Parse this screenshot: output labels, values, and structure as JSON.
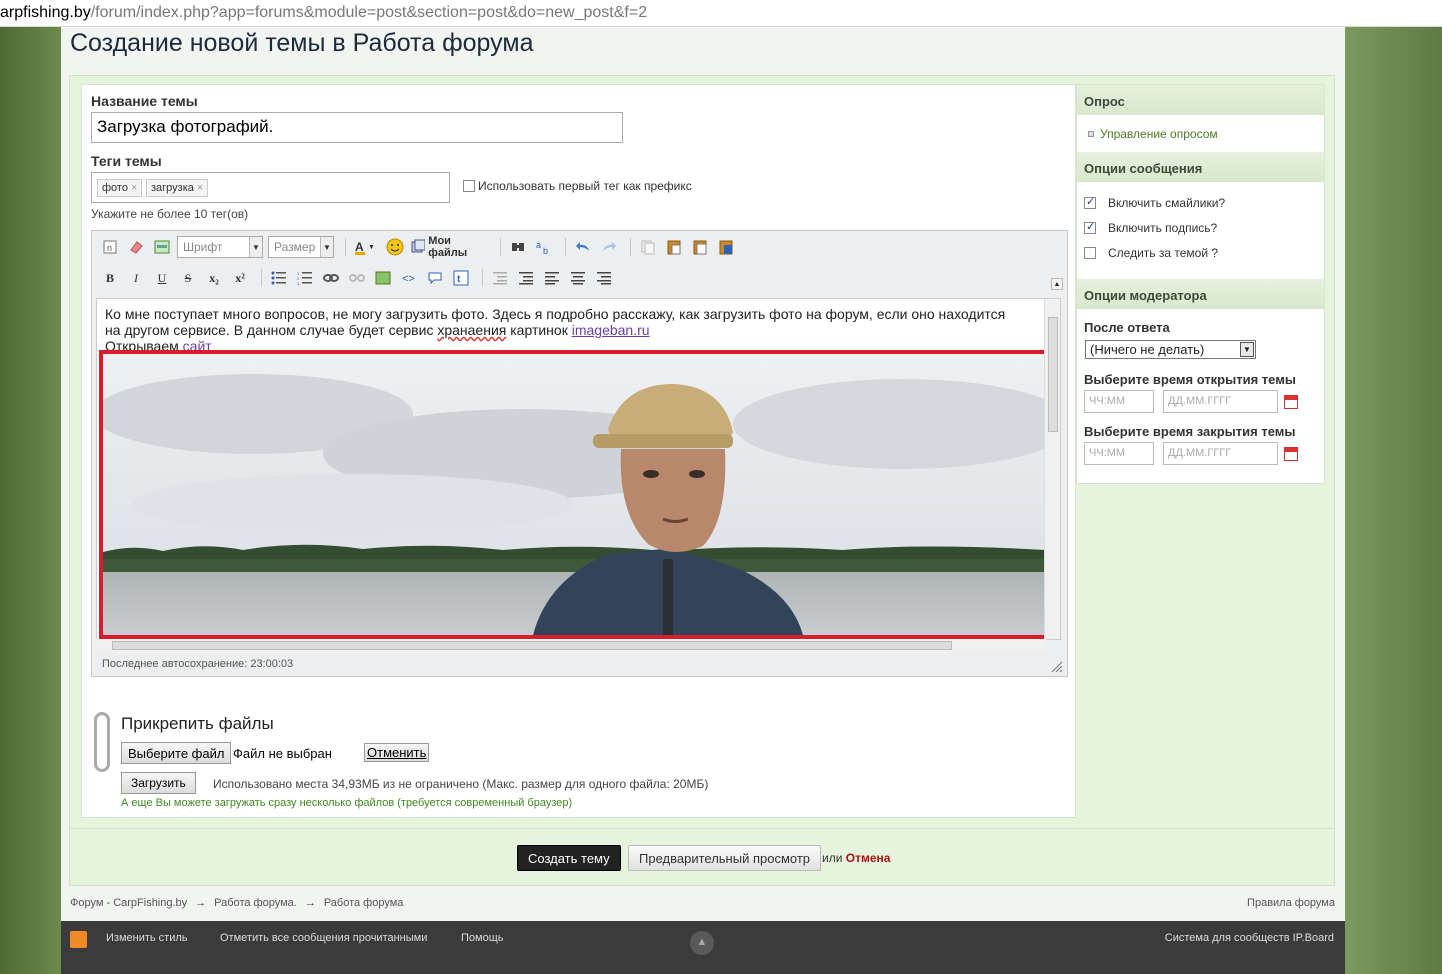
{
  "browser": {
    "url_host": "arpfishing.by",
    "url_path": "/forum/index.php?app=forums&module=post&section=post&do=new_post&f=2"
  },
  "page": {
    "title": "Создание новой темы в Работа форума"
  },
  "form": {
    "topic_label": "Название темы",
    "topic_value": "Загрузка фотографий.",
    "tags_label": "Теги темы",
    "tags": [
      "фото",
      "загрузка"
    ],
    "tag_remove_glyph": "×",
    "prefix_checkbox_label": "Использовать первый тег как префикс",
    "tags_hint": "Укажите не более 10 тег(ов)"
  },
  "editor": {
    "font_placeholder": "Шрифт",
    "size_placeholder": "Размер",
    "my_files_label": "Мои файлы",
    "text_line1": "Ко мне поступает много вопросов, не могу загрузить фото. Здесь я подробно расскажу, как загрузить фото на форум, если оно находится",
    "text_line2_pre": "на другом сервисе. В данном случае будет сервис ",
    "text_line2_spell": "хранаения",
    "text_line2_mid": " картинок  ",
    "text_line2_link": "imageban.ru",
    "text_line3_pre": "Открываем ",
    "text_line3_link": "сайт",
    "autosave": "Последнее автосохранение: 23:00:03",
    "format_buttons": [
      "B",
      "I",
      "U",
      "S",
      "x₂",
      "x²"
    ]
  },
  "attachments": {
    "title": "Прикрепить файлы",
    "choose_button": "Выберите файл",
    "no_file": "Файл не выбран",
    "cancel_button": "Отменить",
    "upload_button": "Загрузить",
    "usage_text": "Использовано места 34,93МБ из не ограничено (Макс. размер для одного файла: 20МБ)",
    "multi_note": "А еще Вы можете загружать сразу несколько файлов (требуется современный браузер)"
  },
  "sidebar": {
    "poll_header": "Опрос",
    "poll_link": "Управление опросом",
    "options_header": "Опции сообщения",
    "options": [
      {
        "label": "Включить смайлики?",
        "checked": true
      },
      {
        "label": "Включить подпись?",
        "checked": true
      },
      {
        "label": "Следить за темой ?",
        "checked": false
      }
    ],
    "mod_header": "Опции модератора",
    "after_reply_label": "После ответа",
    "after_reply_value": "(Ничего не делать)",
    "open_time_label": "Выберите время открытия темы",
    "close_time_label": "Выберите время закрытия темы",
    "time_placeholder": "ЧЧ:ММ",
    "date_placeholder": "ДД.ММ.ГГГГ"
  },
  "submit": {
    "create_button": "Создать тему",
    "preview_button": "Предварительный просмотр",
    "or_text": "или",
    "cancel_link": "Отмена"
  },
  "breadcrumb": {
    "items": [
      "Форум - CarpFishing.by",
      "Работа форума.",
      "Работа форума"
    ],
    "separator": "→",
    "rules_link": "Правила форума"
  },
  "footer": {
    "change_style": "Изменить стиль",
    "mark_read": "Отметить все сообщения прочитанными",
    "help": "Помощь",
    "powered": "Система для сообществ IP.Board"
  },
  "colors": {
    "highlight_frame": "#d61f2a",
    "link_green": "#4a7a23",
    "cancel_red": "#aa1111"
  }
}
